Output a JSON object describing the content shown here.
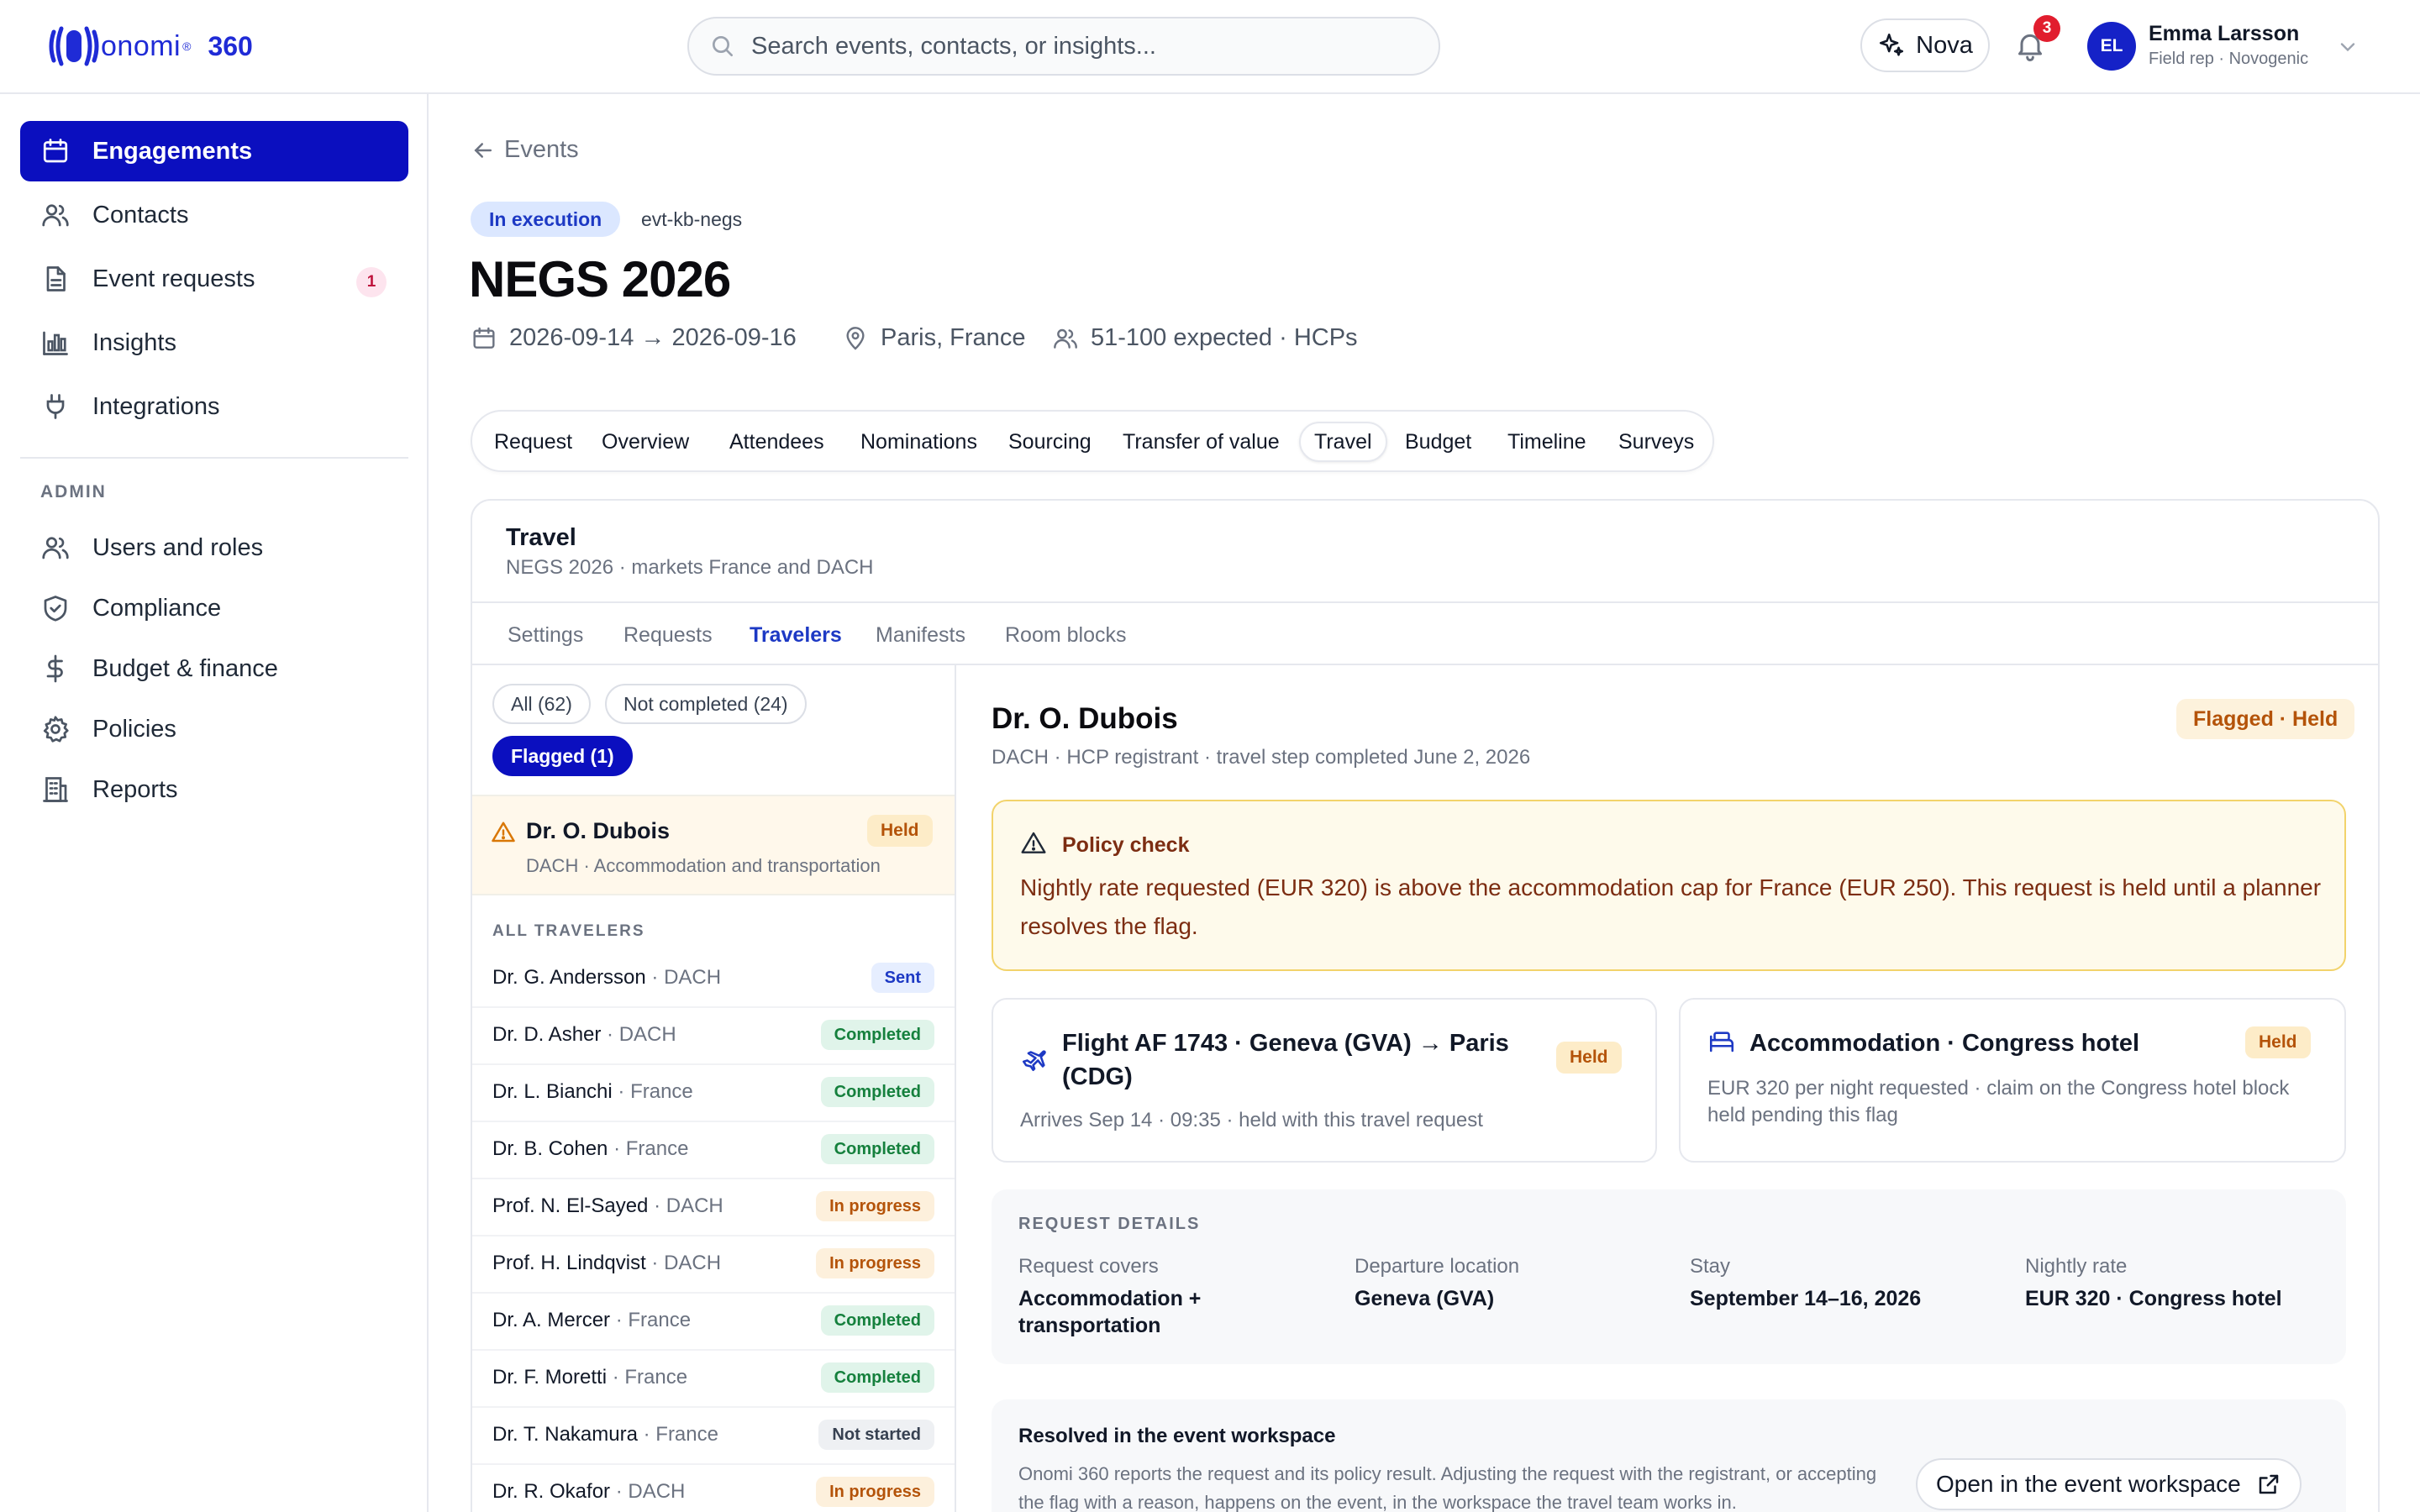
{
  "app": {
    "brand": "onomi",
    "brand_reg": "®",
    "brand_suffix": "360"
  },
  "search": {
    "placeholder": "Search events, contacts, or insights..."
  },
  "header": {
    "nova_label": "Nova",
    "notifications_count": "3",
    "user_initials": "EL",
    "user_name": "Emma Larsson",
    "user_role": "Field rep · Novogenic"
  },
  "sidebar": {
    "items": [
      {
        "label": "Engagements",
        "icon": "calendar-icon"
      },
      {
        "label": "Contacts",
        "icon": "users-icon"
      },
      {
        "label": "Event requests",
        "icon": "document-icon",
        "badge": "1"
      },
      {
        "label": "Insights",
        "icon": "bar-chart-icon"
      },
      {
        "label": "Integrations",
        "icon": "plug-icon"
      }
    ],
    "admin_label": "ADMIN",
    "admin_items": [
      {
        "label": "Users and roles",
        "icon": "users-icon"
      },
      {
        "label": "Compliance",
        "icon": "shield-icon"
      },
      {
        "label": "Budget & finance",
        "icon": "dollar-icon"
      },
      {
        "label": "Policies",
        "icon": "gear-icon"
      },
      {
        "label": "Reports",
        "icon": "building-icon"
      }
    ]
  },
  "event": {
    "back_label": "Events",
    "status": "In execution",
    "id": "evt-kb-negs",
    "title": "NEGS 2026",
    "dates": "2026-09-14 → 2026-09-16",
    "location": "Paris, France",
    "audience": "51-100 expected · HCPs"
  },
  "tabs": [
    "Request",
    "Overview",
    "Attendees",
    "Nominations",
    "Sourcing",
    "Transfer of value",
    "Travel",
    "Budget",
    "Timeline",
    "Surveys"
  ],
  "active_tab": "Travel",
  "travel": {
    "title": "Travel",
    "subtitle": "NEGS 2026 · markets France and DACH",
    "subtabs": [
      "Settings",
      "Requests",
      "Travelers",
      "Manifests",
      "Room blocks"
    ],
    "active_subtab": "Travelers",
    "filters": {
      "all": "All (62)",
      "not_completed": "Not completed (24)",
      "flagged": "Flagged (1)"
    },
    "flagged_item": {
      "name": "Dr. O. Dubois",
      "sub": "DACH · Accommodation and transportation",
      "status": "Held"
    },
    "all_label": "ALL TRAVELERS",
    "travelers": [
      {
        "name": "Dr. G. Andersson",
        "region": " · DACH",
        "status": "Sent"
      },
      {
        "name": "Dr. D. Asher",
        "region": " · DACH",
        "status": "Completed"
      },
      {
        "name": "Dr. L. Bianchi",
        "region": " · France",
        "status": "Completed"
      },
      {
        "name": "Dr. B. Cohen",
        "region": " · France",
        "status": "Completed"
      },
      {
        "name": "Prof. N. El-Sayed",
        "region": " · DACH",
        "status": "In progress"
      },
      {
        "name": "Prof. H. Lindqvist",
        "region": " · DACH",
        "status": "In progress"
      },
      {
        "name": "Dr. A. Mercer",
        "region": " · France",
        "status": "Completed"
      },
      {
        "name": "Dr. F. Moretti",
        "region": " · France",
        "status": "Completed"
      },
      {
        "name": "Dr. T. Nakamura",
        "region": " · France",
        "status": "Not started"
      },
      {
        "name": "Dr. R. Okafor",
        "region": " · DACH",
        "status": "In progress"
      }
    ]
  },
  "detail": {
    "name": "Dr. O. Dubois",
    "sub": "DACH · HCP registrant · travel step completed June 2, 2026",
    "badge": "Flagged · Held",
    "policy_title": "Policy check",
    "policy_body": "Nightly rate requested (EUR 320) is above the accommodation cap for France (EUR 250). This request is held until a planner resolves the flag.",
    "flight": {
      "title": "Flight AF 1743 · Geneva (GVA) → Paris (CDG)",
      "sub": "Arrives Sep 14 · 09:35 · held with this travel request",
      "status": "Held"
    },
    "accommodation": {
      "title": "Accommodation · Congress hotel",
      "sub": "EUR 320 per night requested · claim on the Congress hotel block held pending this flag",
      "status": "Held"
    },
    "request_details": {
      "label": "REQUEST DETAILS",
      "covers_k": "Request covers",
      "covers_v": "Accommodation + transportation",
      "departure_k": "Departure location",
      "departure_v": "Geneva (GVA)",
      "stay_k": "Stay",
      "stay_v": "September 14–16, 2026",
      "rate_k": "Nightly rate",
      "rate_v": "EUR 320 · Congress hotel"
    },
    "resolved": {
      "title": "Resolved in the event workspace",
      "body": "Onomi 360 reports the request and its policy result. Adjusting the request with the registrant, or accepting the flag with a reason, happens on the event, in the workspace the travel team works in.",
      "button": "Open in the event workspace"
    }
  },
  "colors": {
    "accent": "#0b0fbf",
    "brand": "#1f2bd6",
    "held": "#b45309",
    "completed": "#15803d",
    "policy_bg": "#fefaeb"
  }
}
